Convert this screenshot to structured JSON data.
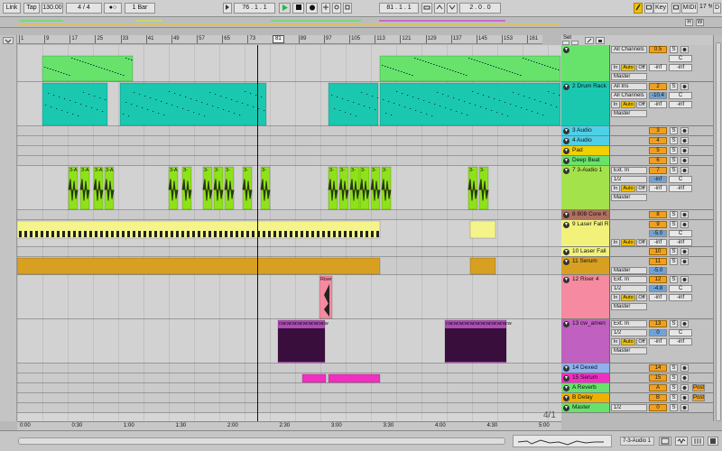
{
  "transport": {
    "link": "Link",
    "tap": "Tap",
    "tempo": "130.00",
    "sig_num": "4",
    "sig_slash": "/",
    "sig_den": "4",
    "metronome": "●○",
    "quantize": "1 Bar",
    "position": "76 .  1 .  1",
    "loop_start": "81 .  1 .  1",
    "loop_length": "2 .  0 .  0",
    "key": "Key",
    "midi": "MIDI",
    "cpu": "17 %",
    "d_label": "D"
  },
  "overview": {
    "h_btn": "H",
    "w_btn": "W"
  },
  "ruler": {
    "bars": [
      "1",
      "9",
      "17",
      "25",
      "33",
      "41",
      "49",
      "57",
      "65",
      "73",
      "81",
      "89",
      "97",
      "105",
      "113",
      "121",
      "129",
      "137",
      "145",
      "153",
      "161"
    ],
    "loop_marker": "81"
  },
  "set_label": "Set",
  "time_ruler": [
    "0:00",
    "0:30",
    "1:00",
    "1:30",
    "2:00",
    "2:30",
    "3:00",
    "3:30",
    "4:00",
    "4:30",
    "5:00"
  ],
  "time_signature_marker": "4/1",
  "tracks": [
    {
      "id": "t1",
      "name": "",
      "color": "#67e36b",
      "height": 41,
      "in": "All Channels",
      "num": "0.5",
      "sel": "C",
      "vol_l": "-inf",
      "vol_r": "-inf",
      "out": "Master",
      "has_io": true
    },
    {
      "id": "t2",
      "name": "2 Drum Rack",
      "color": "#1ac8b0",
      "height": 49,
      "in": "All Ins",
      "num": "2",
      "in2": "All Channels",
      "vol": "-10.4",
      "sel": "C",
      "vol_l": "-inf",
      "vol_r": "-inf",
      "out": "Master",
      "has_io": true
    },
    {
      "id": "t3",
      "name": "3 Audio",
      "color": "#4ed0e8",
      "height": 11,
      "num": "3"
    },
    {
      "id": "t4",
      "name": "4 Audio",
      "color": "#4ed0e8",
      "height": 11,
      "num": "4"
    },
    {
      "id": "t5",
      "name": "Pad",
      "color": "#f0d000",
      "height": 11,
      "num": "5"
    },
    {
      "id": "t6",
      "name": "Deep Beat",
      "color": "#67e36b",
      "height": 11,
      "num": "6"
    },
    {
      "id": "t7",
      "name": "7 3-Audio 1",
      "color": "#a3e24a",
      "height": 49,
      "in": "Ext. In",
      "in2": "1/2",
      "num": "7",
      "vol": "-inf",
      "sel": "C",
      "vol_l": "-inf",
      "vol_r": "-inf",
      "out": "Master",
      "has_io": true
    },
    {
      "id": "t8",
      "name": "8 808 Core K",
      "color": "#b07060",
      "height": 11,
      "num": "8"
    },
    {
      "id": "t9",
      "name": "9 Laser Fall R",
      "color": "#f2f27a",
      "height": 30,
      "num": "9",
      "vol": "-5.0",
      "sel": "C",
      "vol_l": "-inf",
      "vol_r": "-inf",
      "out": "Master",
      "has_io": true
    },
    {
      "id": "t10",
      "name": "10 Laser Fall",
      "color": "#f2f27a",
      "height": 11,
      "num": "10"
    },
    {
      "id": "t11",
      "name": "11 Serum",
      "color": "#d8a020",
      "height": 20,
      "num": "11",
      "out": "Master",
      "vol": "-5.0"
    },
    {
      "id": "t12",
      "name": "12 Riser 4",
      "color": "#f58aa0",
      "height": 49,
      "in": "Ext. In",
      "in2": "1/2",
      "num": "12",
      "vol": "-4.8",
      "sel": "C",
      "vol_l": "-inf",
      "vol_r": "-inf",
      "out": "Master",
      "has_io": true
    },
    {
      "id": "t13",
      "name": "13 cw_amen",
      "color": "#c060c0",
      "height": 49,
      "in": "Ext. In",
      "in2": "1/2",
      "num": "13",
      "vol": "0",
      "sel": "C",
      "vol_l": "-inf",
      "vol_r": "-inf",
      "out": "Master",
      "has_io": true
    },
    {
      "id": "t14",
      "name": "14 Dexed",
      "color": "#90b0f0",
      "height": 11,
      "num": "14"
    },
    {
      "id": "t15",
      "name": "15 Serum",
      "color": "#f030c0",
      "height": 11,
      "num": "15"
    },
    {
      "id": "tA",
      "name": "A Reverb",
      "color": "#67e36b",
      "height": 11,
      "num": "A",
      "post": "Post"
    },
    {
      "id": "tB",
      "name": "B Delay",
      "color": "#f0b000",
      "height": 11,
      "num": "B",
      "post": "Post"
    },
    {
      "id": "tM",
      "name": "Master",
      "color": "#67e36b",
      "height": 11,
      "num": "0",
      "in": "1/2"
    }
  ],
  "clip_labels": {
    "audio3": "3-A",
    "audio3b": "3-",
    "riser": "Riser",
    "amen": "cw"
  },
  "bottom": {
    "selected_track": "7-3-Audio 1"
  },
  "colors": {
    "green": "#67e36b",
    "teal": "#1ac8b0",
    "lime": "#8ee21a",
    "yellow": "#f4f48a",
    "orange": "#d8a020",
    "pink": "#f58aa0",
    "purple": "#b24ab8",
    "magenta": "#f030c0"
  }
}
